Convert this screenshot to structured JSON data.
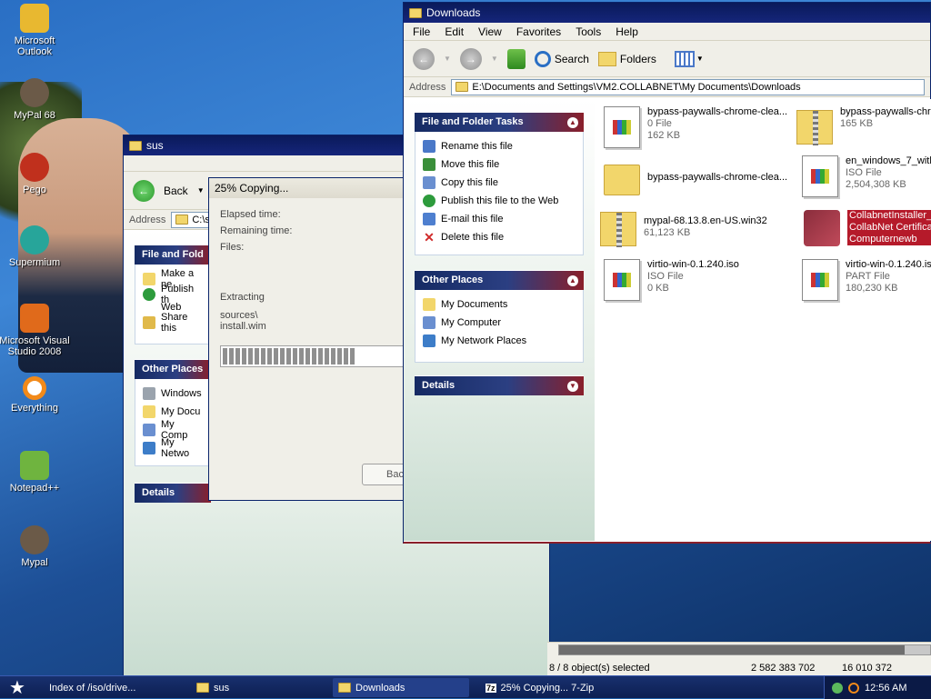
{
  "desktop": {
    "icons": [
      {
        "label": "Microsoft Outlook",
        "icon": "outlook-icon",
        "color": "#e8b830"
      },
      {
        "label": "MyPal 68",
        "icon": "raccoon-icon",
        "color": "#6b5a48"
      },
      {
        "label": "Pego",
        "icon": "red-ball-icon",
        "color": "#c0301d"
      },
      {
        "label": "Supermium",
        "icon": "supermium-icon",
        "color": "#27a59a"
      },
      {
        "label": "Microsoft Visual Studio 2008",
        "icon": "visual-studio-icon",
        "color": "#e06a1b"
      },
      {
        "label": "Everything",
        "icon": "everything-icon",
        "color": "#f28a1a"
      },
      {
        "label": "Notepad++",
        "icon": "notepadpp-icon",
        "color": "#6fb43f"
      },
      {
        "label": "Mypal",
        "icon": "raccoon-icon",
        "color": "#6b5a48"
      }
    ]
  },
  "sus_window": {
    "title": "sus",
    "back_label": "Back",
    "address_label": "Address",
    "address_value": "C:\\s",
    "file_tasks_header": "File and Fold",
    "file_tasks": [
      "Make a ne",
      "Publish th",
      "Web",
      "Share this"
    ],
    "other_places_header": "Other Places",
    "other_places": [
      "Windows",
      "My Docu",
      "My Comp",
      "My Netwo"
    ],
    "details_header": "Details",
    "status_selected": "8 / 8 object(s) selected",
    "status_size1": "2 582 383 702",
    "status_size2": "16 010 372"
  },
  "copy_dialog": {
    "title": "25% Copying...",
    "elapsed_label": "Elapsed time:",
    "remaining_label": "Remaining time:",
    "files_label": "Files:",
    "operation": "Extracting",
    "path_line1": "sources\\",
    "path_line2": "install.wim",
    "progress": 0.25,
    "back_button": "Bac"
  },
  "downloads_window": {
    "title": "Downloads",
    "menu": [
      "File",
      "Edit",
      "View",
      "Favorites",
      "Tools",
      "Help"
    ],
    "toolbar": {
      "search": "Search",
      "folders": "Folders"
    },
    "address_label": "Address",
    "address_value": "E:\\Documents and Settings\\VM2.COLLABNET\\My Documents\\Downloads",
    "file_tasks_header": "File and Folder Tasks",
    "file_tasks": [
      {
        "label": "Rename this file",
        "icon": "rename-icon",
        "color": "#4a78c8"
      },
      {
        "label": "Move this file",
        "icon": "move-icon",
        "color": "#3a8f3a"
      },
      {
        "label": "Copy this file",
        "icon": "copy-icon",
        "color": "#6a8fd0"
      },
      {
        "label": "Publish this file to the Web",
        "icon": "globe-icon",
        "color": "#2d9b3c"
      },
      {
        "label": "E-mail this file",
        "icon": "email-icon",
        "color": "#4e7fcf"
      },
      {
        "label": "Delete this file",
        "icon": "delete-icon",
        "color": "#d02a2a"
      }
    ],
    "other_places_header": "Other Places",
    "other_places": [
      {
        "label": "My Documents",
        "icon": "folder-icon",
        "color": "#f2d66b"
      },
      {
        "label": "My Computer",
        "icon": "computer-icon",
        "color": "#6a8fd0"
      },
      {
        "label": "My Network Places",
        "icon": "network-icon",
        "color": "#3d7dc8"
      }
    ],
    "details_header": "Details",
    "files": [
      {
        "name": "bypass-paywalls-chrome-clea...",
        "type": "0 File",
        "size": "162 KB",
        "icon": "file-icon"
      },
      {
        "name": "bypass-paywalls-chr",
        "type": "165 KB",
        "size": "",
        "icon": "zip-folder-icon"
      },
      {
        "name": "bypass-paywalls-chrome-clea...",
        "type": "",
        "size": "",
        "icon": "folder-icon"
      },
      {
        "name": "en_windows_7_with",
        "type": "ISO File",
        "size": "2,504,308 KB",
        "icon": "file-icon"
      },
      {
        "name": "mypal-68.13.8.en-US.win32",
        "type": "61,123 KB",
        "size": "",
        "icon": "zip-folder-icon"
      },
      {
        "name": "CollabnetInstaller_la",
        "type": "CollabNet Certificat",
        "size": "Computernewb",
        "icon": "installer-icon"
      },
      {
        "name": "virtio-win-0.1.240.iso",
        "type": "ISO File",
        "size": "0 KB",
        "icon": "file-icon"
      },
      {
        "name": "virtio-win-0.1.240.is",
        "type": "PART File",
        "size": "180,230 KB",
        "icon": "file-icon"
      }
    ]
  },
  "taskbar": {
    "tasks": [
      "Index of /iso/drive...",
      "sus",
      "Downloads",
      "25% Copying... 7-Zip"
    ],
    "time": "12:56 AM"
  }
}
